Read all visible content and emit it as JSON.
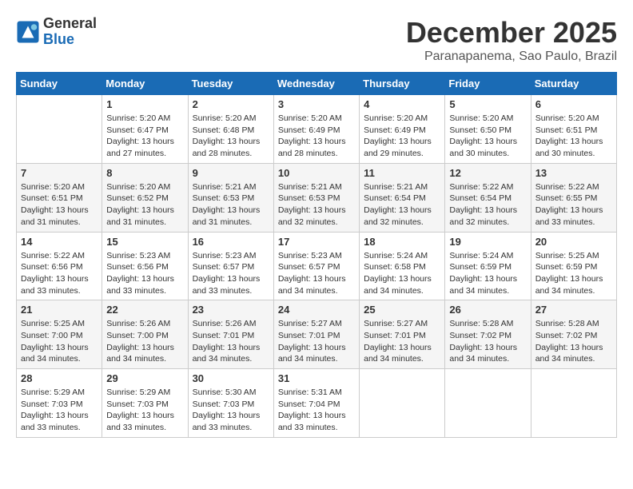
{
  "header": {
    "logo_general": "General",
    "logo_blue": "Blue",
    "month_title": "December 2025",
    "location": "Paranapanema, Sao Paulo, Brazil"
  },
  "days_of_week": [
    "Sunday",
    "Monday",
    "Tuesday",
    "Wednesday",
    "Thursday",
    "Friday",
    "Saturday"
  ],
  "weeks": [
    [
      {
        "day": "",
        "sunrise": "",
        "sunset": "",
        "daylight": ""
      },
      {
        "day": "1",
        "sunrise": "Sunrise: 5:20 AM",
        "sunset": "Sunset: 6:47 PM",
        "daylight": "Daylight: 13 hours and 27 minutes."
      },
      {
        "day": "2",
        "sunrise": "Sunrise: 5:20 AM",
        "sunset": "Sunset: 6:48 PM",
        "daylight": "Daylight: 13 hours and 28 minutes."
      },
      {
        "day": "3",
        "sunrise": "Sunrise: 5:20 AM",
        "sunset": "Sunset: 6:49 PM",
        "daylight": "Daylight: 13 hours and 28 minutes."
      },
      {
        "day": "4",
        "sunrise": "Sunrise: 5:20 AM",
        "sunset": "Sunset: 6:49 PM",
        "daylight": "Daylight: 13 hours and 29 minutes."
      },
      {
        "day": "5",
        "sunrise": "Sunrise: 5:20 AM",
        "sunset": "Sunset: 6:50 PM",
        "daylight": "Daylight: 13 hours and 30 minutes."
      },
      {
        "day": "6",
        "sunrise": "Sunrise: 5:20 AM",
        "sunset": "Sunset: 6:51 PM",
        "daylight": "Daylight: 13 hours and 30 minutes."
      }
    ],
    [
      {
        "day": "7",
        "sunrise": "Sunrise: 5:20 AM",
        "sunset": "Sunset: 6:51 PM",
        "daylight": "Daylight: 13 hours and 31 minutes."
      },
      {
        "day": "8",
        "sunrise": "Sunrise: 5:20 AM",
        "sunset": "Sunset: 6:52 PM",
        "daylight": "Daylight: 13 hours and 31 minutes."
      },
      {
        "day": "9",
        "sunrise": "Sunrise: 5:21 AM",
        "sunset": "Sunset: 6:53 PM",
        "daylight": "Daylight: 13 hours and 31 minutes."
      },
      {
        "day": "10",
        "sunrise": "Sunrise: 5:21 AM",
        "sunset": "Sunset: 6:53 PM",
        "daylight": "Daylight: 13 hours and 32 minutes."
      },
      {
        "day": "11",
        "sunrise": "Sunrise: 5:21 AM",
        "sunset": "Sunset: 6:54 PM",
        "daylight": "Daylight: 13 hours and 32 minutes."
      },
      {
        "day": "12",
        "sunrise": "Sunrise: 5:22 AM",
        "sunset": "Sunset: 6:54 PM",
        "daylight": "Daylight: 13 hours and 32 minutes."
      },
      {
        "day": "13",
        "sunrise": "Sunrise: 5:22 AM",
        "sunset": "Sunset: 6:55 PM",
        "daylight": "Daylight: 13 hours and 33 minutes."
      }
    ],
    [
      {
        "day": "14",
        "sunrise": "Sunrise: 5:22 AM",
        "sunset": "Sunset: 6:56 PM",
        "daylight": "Daylight: 13 hours and 33 minutes."
      },
      {
        "day": "15",
        "sunrise": "Sunrise: 5:23 AM",
        "sunset": "Sunset: 6:56 PM",
        "daylight": "Daylight: 13 hours and 33 minutes."
      },
      {
        "day": "16",
        "sunrise": "Sunrise: 5:23 AM",
        "sunset": "Sunset: 6:57 PM",
        "daylight": "Daylight: 13 hours and 33 minutes."
      },
      {
        "day": "17",
        "sunrise": "Sunrise: 5:23 AM",
        "sunset": "Sunset: 6:57 PM",
        "daylight": "Daylight: 13 hours and 34 minutes."
      },
      {
        "day": "18",
        "sunrise": "Sunrise: 5:24 AM",
        "sunset": "Sunset: 6:58 PM",
        "daylight": "Daylight: 13 hours and 34 minutes."
      },
      {
        "day": "19",
        "sunrise": "Sunrise: 5:24 AM",
        "sunset": "Sunset: 6:59 PM",
        "daylight": "Daylight: 13 hours and 34 minutes."
      },
      {
        "day": "20",
        "sunrise": "Sunrise: 5:25 AM",
        "sunset": "Sunset: 6:59 PM",
        "daylight": "Daylight: 13 hours and 34 minutes."
      }
    ],
    [
      {
        "day": "21",
        "sunrise": "Sunrise: 5:25 AM",
        "sunset": "Sunset: 7:00 PM",
        "daylight": "Daylight: 13 hours and 34 minutes."
      },
      {
        "day": "22",
        "sunrise": "Sunrise: 5:26 AM",
        "sunset": "Sunset: 7:00 PM",
        "daylight": "Daylight: 13 hours and 34 minutes."
      },
      {
        "day": "23",
        "sunrise": "Sunrise: 5:26 AM",
        "sunset": "Sunset: 7:01 PM",
        "daylight": "Daylight: 13 hours and 34 minutes."
      },
      {
        "day": "24",
        "sunrise": "Sunrise: 5:27 AM",
        "sunset": "Sunset: 7:01 PM",
        "daylight": "Daylight: 13 hours and 34 minutes."
      },
      {
        "day": "25",
        "sunrise": "Sunrise: 5:27 AM",
        "sunset": "Sunset: 7:01 PM",
        "daylight": "Daylight: 13 hours and 34 minutes."
      },
      {
        "day": "26",
        "sunrise": "Sunrise: 5:28 AM",
        "sunset": "Sunset: 7:02 PM",
        "daylight": "Daylight: 13 hours and 34 minutes."
      },
      {
        "day": "27",
        "sunrise": "Sunrise: 5:28 AM",
        "sunset": "Sunset: 7:02 PM",
        "daylight": "Daylight: 13 hours and 34 minutes."
      }
    ],
    [
      {
        "day": "28",
        "sunrise": "Sunrise: 5:29 AM",
        "sunset": "Sunset: 7:03 PM",
        "daylight": "Daylight: 13 hours and 33 minutes."
      },
      {
        "day": "29",
        "sunrise": "Sunrise: 5:29 AM",
        "sunset": "Sunset: 7:03 PM",
        "daylight": "Daylight: 13 hours and 33 minutes."
      },
      {
        "day": "30",
        "sunrise": "Sunrise: 5:30 AM",
        "sunset": "Sunset: 7:03 PM",
        "daylight": "Daylight: 13 hours and 33 minutes."
      },
      {
        "day": "31",
        "sunrise": "Sunrise: 5:31 AM",
        "sunset": "Sunset: 7:04 PM",
        "daylight": "Daylight: 13 hours and 33 minutes."
      },
      {
        "day": "",
        "sunrise": "",
        "sunset": "",
        "daylight": ""
      },
      {
        "day": "",
        "sunrise": "",
        "sunset": "",
        "daylight": ""
      },
      {
        "day": "",
        "sunrise": "",
        "sunset": "",
        "daylight": ""
      }
    ]
  ]
}
